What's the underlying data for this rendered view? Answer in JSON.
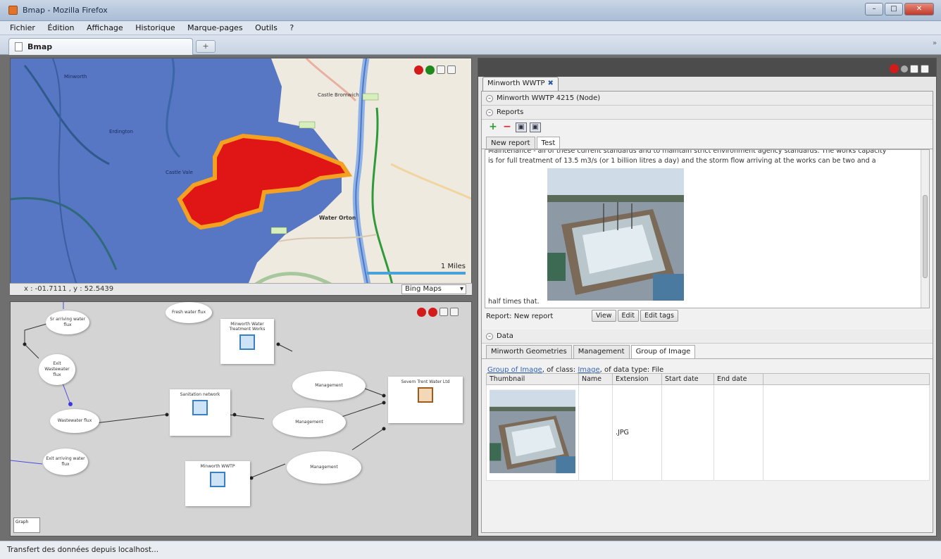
{
  "window": {
    "title": "Bmap - Mozilla Firefox",
    "buttons": [
      "–",
      "□",
      "✕"
    ]
  },
  "menu": [
    "Fichier",
    "Édition",
    "Affichage",
    "Historique",
    "Marque-pages",
    "Outils",
    "?"
  ],
  "browser": {
    "tab_label": "Bmap",
    "new_tab_label": "+",
    "scroll_label": "»"
  },
  "map": {
    "labels": [
      "Castle Bromwich",
      "Minworth",
      "Water Orton",
      "Erdington",
      "Castle Vale"
    ],
    "coords": "x : -01.7111 , y : 52.5439",
    "provider": "Bing Maps",
    "scale_label": "1 Miles"
  },
  "graph": {
    "ovals": [
      "Sr arriving water flux",
      "Exit Wastewater flux",
      "Wastewater flux",
      "Exit arriving water flux",
      "Fresh water flux",
      "Management",
      "Management",
      "Management"
    ],
    "boxes": [
      "Minworth Water Treatment Works",
      "Sanitation network",
      "Minworth WWTP",
      "Severn Trent Water Ltd"
    ],
    "corner_label": "Graph"
  },
  "details": {
    "tab_label": "Minworth WWTP",
    "node_header": "Minworth WWTP 4215 (Node)",
    "reports_header": "Reports",
    "report_tabs": [
      "New report",
      "Test"
    ],
    "report_text_line1": "Maintenance - all of these current standards and to maintain strict environment agency standards. The works capacity",
    "report_text_line2": "is for full treatment of 13.5 m3/s (or 1 billion litres a day) and the storm flow arriving at the works can be two and a",
    "report_text_tail": "half times that.",
    "report_label": "Report:",
    "report_name": "New report",
    "report_buttons": [
      "View",
      "Edit",
      "Edit tags"
    ],
    "data_header": "Data",
    "data_tabs": [
      "Minworth Geometries",
      "Management",
      "Group of Image"
    ],
    "class_link": "Group of Image",
    "class_of": ", of class:",
    "class_name": "Image",
    "class_type": ", of data type: File",
    "columns": [
      "Thumbnail",
      "Name",
      "Extension",
      "Start date",
      "End date"
    ],
    "row_extension": ".JPG"
  },
  "status": "Transfert des données depuis localhost..."
}
